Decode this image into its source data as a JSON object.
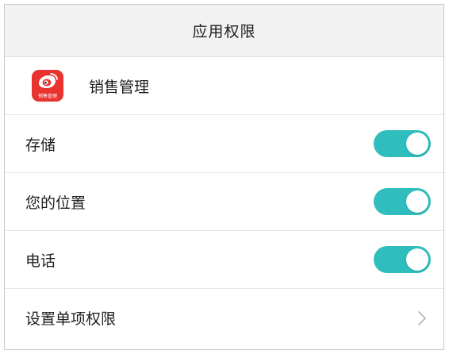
{
  "header": {
    "title": "应用权限"
  },
  "app": {
    "name": "销售管理",
    "icon_caption": "销售管理",
    "icon_color": "#e8332f"
  },
  "permissions": [
    {
      "label": "存储",
      "enabled": true
    },
    {
      "label": "您的位置",
      "enabled": true
    },
    {
      "label": "电话",
      "enabled": true
    }
  ],
  "individual_settings": {
    "label": "设置单项权限",
    "icon": "chevron-right-icon"
  },
  "colors": {
    "toggle_on": "#2fbdbd",
    "header_bg": "#f2f2f2"
  }
}
